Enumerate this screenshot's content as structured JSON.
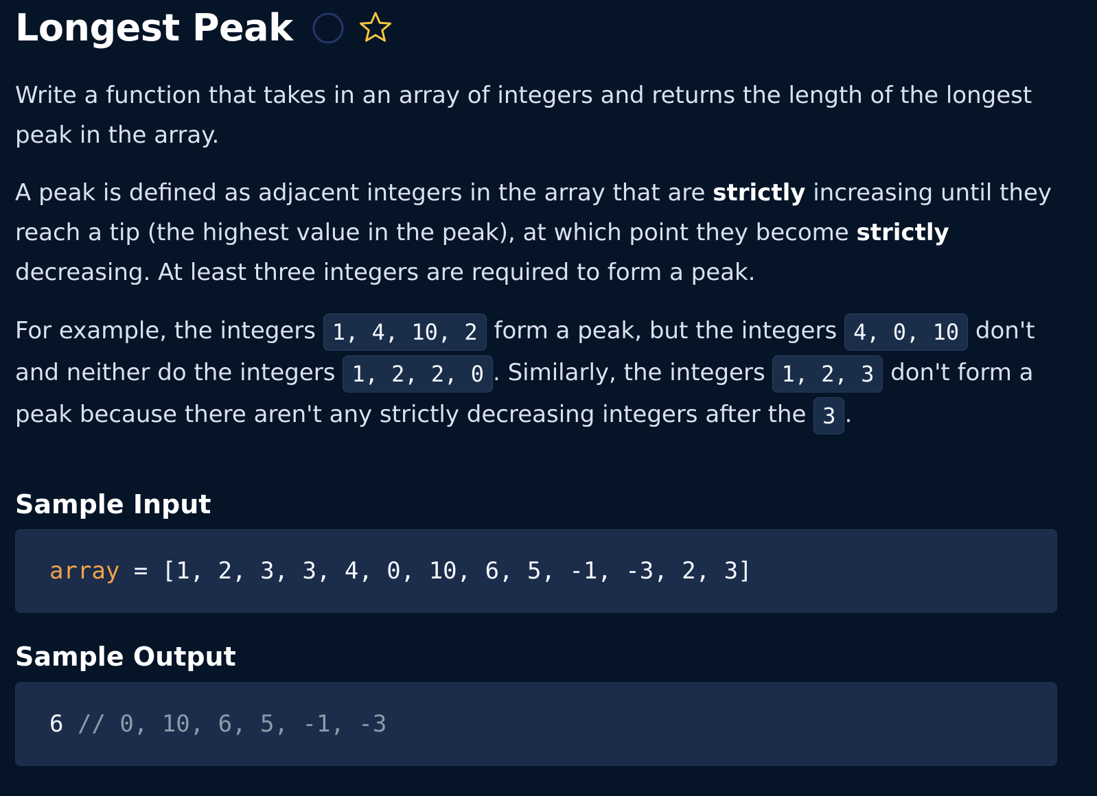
{
  "problem": {
    "title": "Longest Peak",
    "icons": {
      "status": "circle-outline-icon",
      "favorite": "star-outline-icon"
    },
    "colors": {
      "background": "#061427",
      "code_background": "#1b2d4a",
      "status_circle": "#23356a",
      "star": "#f5c542",
      "variable": "#f5a24a",
      "comment": "#8f9aab"
    },
    "description": {
      "p1": "Write a function that takes in an array of integers and returns the length of the longest peak in the array.",
      "p2_a": "A peak is defined as adjacent integers in the array that are ",
      "p2_b": "strictly",
      "p2_c": " increasing until they reach a tip (the highest value in the peak), at which point they become ",
      "p2_d": "strictly",
      "p2_e": " decreasing. At least three integers are required to form a peak.",
      "p3_a": "For example, the integers ",
      "p3_code1": "1, 4, 10, 2",
      "p3_b": " form a peak, but the integers ",
      "p3_code2": "4, 0, 10",
      "p3_c": " don't and neither do the integers ",
      "p3_code3": "1, 2, 2, 0",
      "p3_d": ". Similarly, the integers ",
      "p3_code4": "1, 2, 3",
      "p3_e": " don't form a peak because there aren't any strictly decreasing integers after the ",
      "p3_code5": "3",
      "p3_f": "."
    },
    "sample_input": {
      "title": "Sample Input",
      "variable": "array",
      "operator": " = ",
      "value": "[1, 2, 3, 3, 4, 0, 10, 6, 5, -1, -3, 2, 3]"
    },
    "sample_output": {
      "title": "Sample Output",
      "value": "6",
      "comment": " // 0, 10, 6, 5, -1, -3"
    }
  }
}
